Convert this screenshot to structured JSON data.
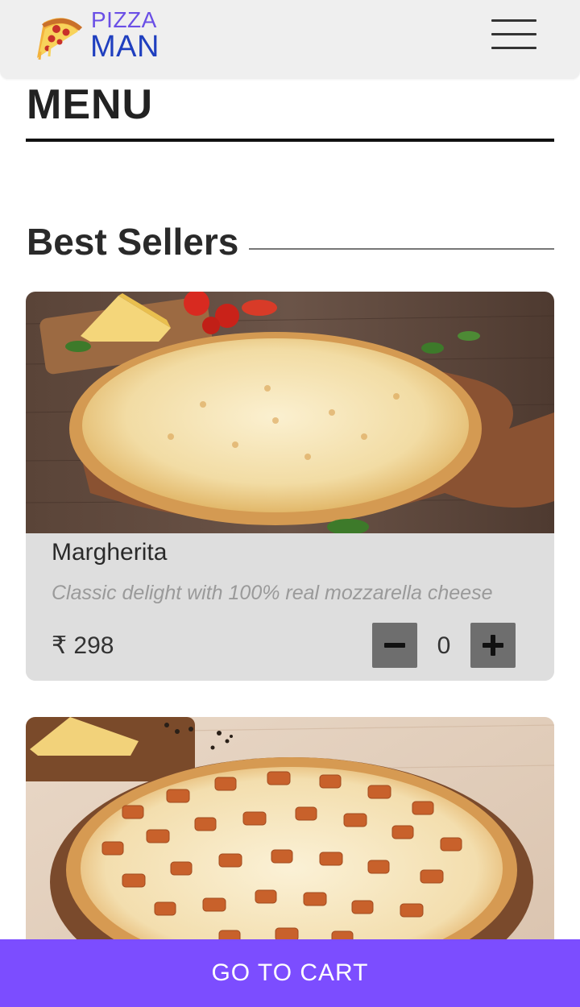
{
  "header": {
    "logo_top": "PIZZA",
    "logo_bottom": "MAN",
    "logo_icon": "pizza-slice-icon",
    "menu_icon": "hamburger-menu-icon"
  },
  "page_title": "MENU",
  "section": {
    "title": "Best Sellers"
  },
  "items": [
    {
      "name": "Margherita",
      "description": "Classic delight with 100% real mozzarella cheese",
      "price": "₹ 298",
      "quantity": "0",
      "image": "margherita-pizza-image"
    },
    {
      "image": "chicken-pizza-image"
    }
  ],
  "cart_button": "GO TO CART",
  "colors": {
    "accent": "#7c4dff",
    "logo_top": "#6a4fe6",
    "logo_bottom": "#1f3fbf",
    "header_bg": "#efefef",
    "card_bg": "#dedede",
    "qty_button": "#6e6e6e"
  }
}
